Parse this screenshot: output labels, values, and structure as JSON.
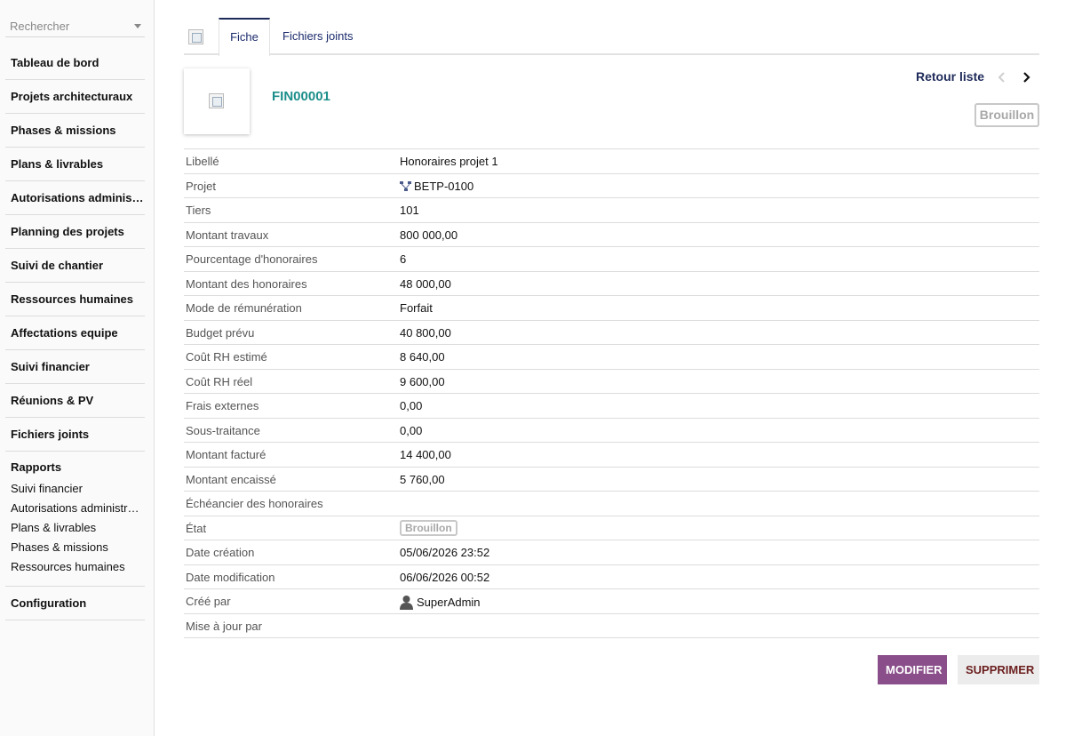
{
  "search": {
    "placeholder": "Rechercher"
  },
  "sidebar": {
    "items": [
      "Tableau de bord",
      "Projets architecturaux",
      "Phases & missions",
      "Plans & livrables",
      "Autorisations administratives",
      "Planning des projets",
      "Suivi de chantier",
      "Ressources humaines",
      "Affectations equipe",
      "Suivi financier",
      "Réunions & PV",
      "Fichiers joints"
    ],
    "reports": {
      "title": "Rapports",
      "links": [
        "Suivi financier",
        "Autorisations administratives",
        "Plans & livrables",
        "Phases & missions",
        "Ressources humaines"
      ]
    },
    "config": "Configuration"
  },
  "tabs": {
    "card": "Fiche",
    "files": "Fichiers joints"
  },
  "header": {
    "ref": "FIN00001",
    "back_label": "Retour liste",
    "status": "Brouillon"
  },
  "fields": [
    {
      "label": "Libellé",
      "value": "Honoraires projet 1"
    },
    {
      "label": "Projet",
      "value": "BETP-0100"
    },
    {
      "label": "Tiers",
      "value": "101"
    },
    {
      "label": "Montant travaux",
      "value": "800 000,00"
    },
    {
      "label": "Pourcentage d'honoraires",
      "value": "6"
    },
    {
      "label": "Montant des honoraires",
      "value": "48 000,00"
    },
    {
      "label": "Mode de rémunération",
      "value": "Forfait"
    },
    {
      "label": "Budget prévu",
      "value": "40 800,00"
    },
    {
      "label": "Coût RH estimé",
      "value": "8 640,00"
    },
    {
      "label": "Coût RH réel",
      "value": "9 600,00"
    },
    {
      "label": "Frais externes",
      "value": "0,00"
    },
    {
      "label": "Sous-traitance",
      "value": "0,00"
    },
    {
      "label": "Montant facturé",
      "value": "14 400,00"
    },
    {
      "label": "Montant encaissé",
      "value": "5 760,00"
    },
    {
      "label": "Échéancier des honoraires",
      "value": ""
    },
    {
      "label": "État",
      "value": "Brouillon"
    },
    {
      "label": "Date création",
      "value": "05/06/2026 23:52"
    },
    {
      "label": "Date modification",
      "value": "06/06/2026 00:52"
    },
    {
      "label": "Créé par",
      "value": "SuperAdmin"
    },
    {
      "label": "Mise à jour par",
      "value": ""
    }
  ],
  "actions": {
    "edit": "MODIFIER",
    "delete": "SUPPRIMER"
  },
  "colors": {
    "accent": "#1e2a5a",
    "ref": "#1c8e8a",
    "edit_button": "#8a4f8a",
    "delete_text": "#6b1e1e"
  }
}
